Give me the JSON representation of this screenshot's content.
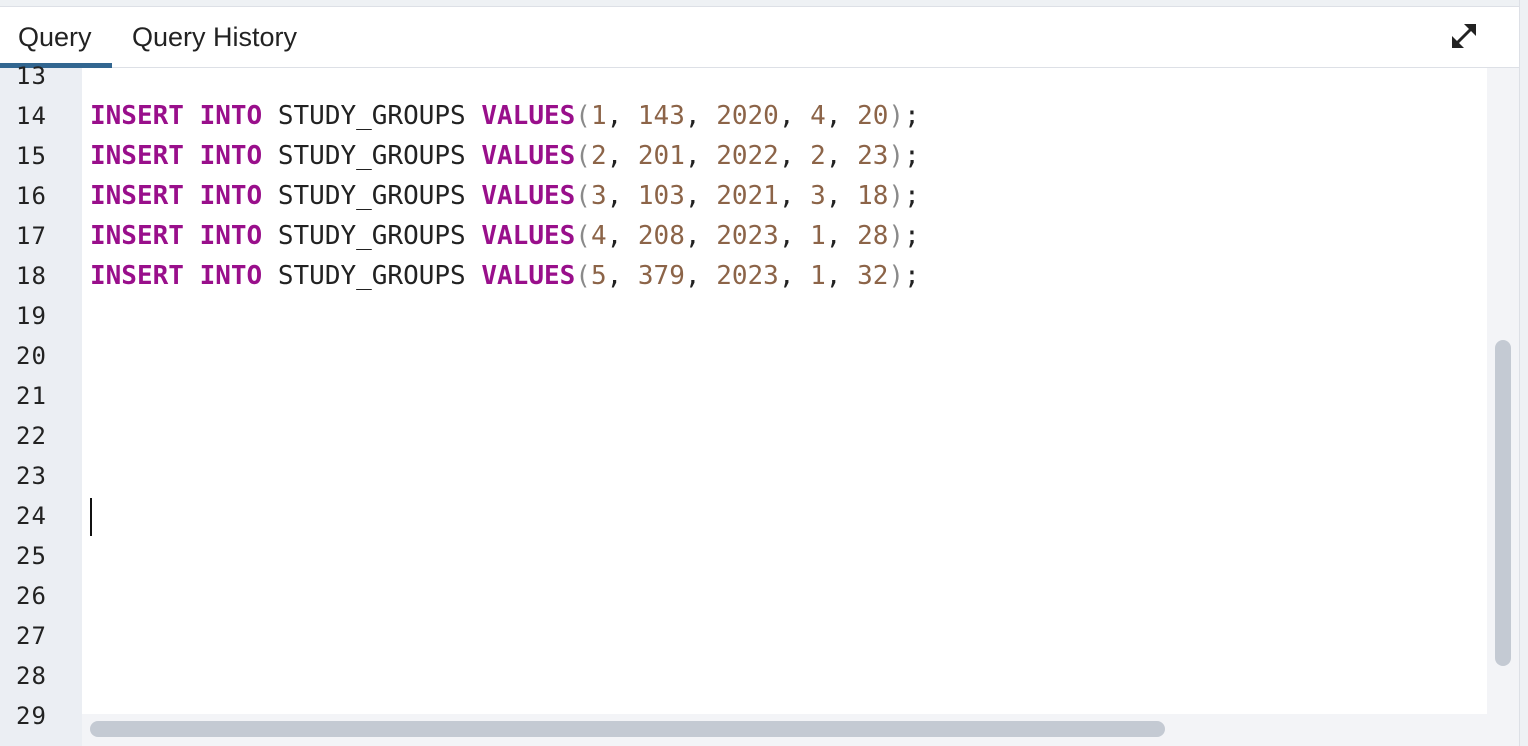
{
  "tabs": {
    "query_label": "Query",
    "history_label": "Query History",
    "active": "Query"
  },
  "toolbar": {
    "expand_icon": "expand-diagonal-icon"
  },
  "editor": {
    "line_numbers": [
      "13",
      "14",
      "15",
      "16",
      "17",
      "18",
      "19",
      "20",
      "21",
      "22",
      "23",
      "24",
      "25",
      "26",
      "27",
      "28",
      "29"
    ],
    "cursor_line": "24",
    "statements": [
      {
        "kw1": "INSERT",
        "kw2": "INTO",
        "table": "STUDY_GROUPS",
        "fn": "VALUES",
        "v1": "1",
        "v2": "143",
        "v3": "2020",
        "v4": "4",
        "v5": "20"
      },
      {
        "kw1": "INSERT",
        "kw2": "INTO",
        "table": "STUDY_GROUPS",
        "fn": "VALUES",
        "v1": "2",
        "v2": "201",
        "v3": "2022",
        "v4": "2",
        "v5": "23"
      },
      {
        "kw1": "INSERT",
        "kw2": "INTO",
        "table": "STUDY_GROUPS",
        "fn": "VALUES",
        "v1": "3",
        "v2": "103",
        "v3": "2021",
        "v4": "3",
        "v5": "18"
      },
      {
        "kw1": "INSERT",
        "kw2": "INTO",
        "table": "STUDY_GROUPS",
        "fn": "VALUES",
        "v1": "4",
        "v2": "208",
        "v3": "2023",
        "v4": "1",
        "v5": "28"
      },
      {
        "kw1": "INSERT",
        "kw2": "INTO",
        "table": "STUDY_GROUPS",
        "fn": "VALUES",
        "v1": "5",
        "v2": "379",
        "v3": "2023",
        "v4": "1",
        "v5": "32"
      }
    ]
  },
  "colors": {
    "keyword": "#990f8b",
    "number": "#8c6448",
    "tab_accent": "#326690",
    "gutter_bg": "#ebeef3"
  }
}
